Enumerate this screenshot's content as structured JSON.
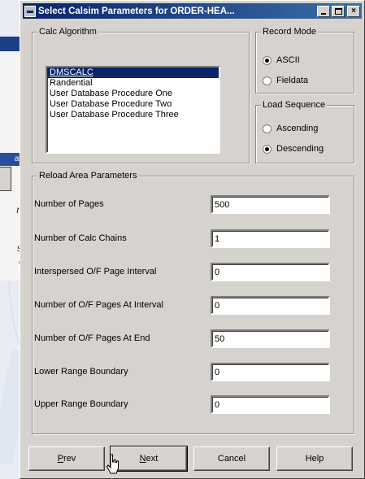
{
  "background": {
    "tab_label": "atio",
    "text_lines": [
      "n!",
      "o",
      "e",
      "s.",
      "r!"
    ]
  },
  "window": {
    "title": "Select Calsim Parameters for ORDER-HEA...",
    "icon": "app-icon",
    "controls": [
      "minimize-icon",
      "maximize-icon",
      "close-icon"
    ],
    "close_glyph": "×"
  },
  "calc_algorithm": {
    "label": "Calc Algorithm",
    "items": [
      {
        "label": "DMSCALC",
        "selected": true
      },
      {
        "label": "Randential",
        "selected": false
      },
      {
        "label": "User Database Procedure One",
        "selected": false
      },
      {
        "label": "User Database Procedure Two",
        "selected": false
      },
      {
        "label": "User Database Procedure Three",
        "selected": false
      }
    ]
  },
  "record_mode": {
    "label": "Record Mode",
    "options": [
      {
        "label": "ASCII",
        "checked": true
      },
      {
        "label": "Fieldata",
        "checked": false
      }
    ]
  },
  "load_sequence": {
    "label": "Load Sequence",
    "options": [
      {
        "label": "Ascending",
        "checked": false
      },
      {
        "label": "Descending",
        "checked": true
      }
    ]
  },
  "reload_area": {
    "label": "Reload Area Parameters",
    "params": [
      {
        "label": "Number of Pages",
        "value": "500"
      },
      {
        "label": "Number of Calc Chains",
        "value": "1"
      },
      {
        "label": "Interspersed O/F Page Interval",
        "value": "0"
      },
      {
        "label": "Number of O/F Pages At Interval",
        "value": "0"
      },
      {
        "label": "Number of O/F Pages At  End",
        "value": "50"
      },
      {
        "label": "Lower Range Boundary",
        "value": "0"
      },
      {
        "label": "Upper Range Boundary",
        "value": "0"
      }
    ]
  },
  "buttons": {
    "prev": {
      "mnemonic": "P",
      "rest": "rev"
    },
    "next": {
      "mnemonic": "N",
      "rest": "ext"
    },
    "cancel": "Cancel",
    "help": "Help"
  },
  "colors": {
    "dialog_face": "#d6d3ce",
    "title_bar": "#0a246a",
    "selection": "#0a246a"
  }
}
